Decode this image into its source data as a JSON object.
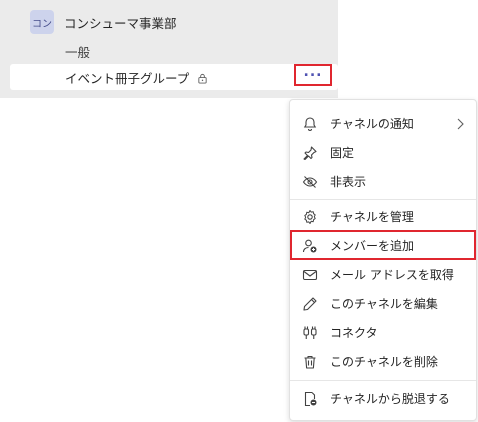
{
  "team": {
    "avatar_text": "コン",
    "name": "コンシューマ事業部"
  },
  "channels": {
    "general": "一般",
    "selected": "イベント冊子グループ"
  },
  "menu": {
    "items": [
      {
        "label": "チャネルの通知",
        "icon": "bell-icon"
      },
      {
        "label": "固定",
        "icon": "pin-icon"
      },
      {
        "label": "非表示",
        "icon": "eye-off-icon"
      },
      {
        "label": "チャネルを管理",
        "icon": "gear-icon"
      },
      {
        "label": "メンバーを追加",
        "icon": "add-member-icon"
      },
      {
        "label": "メール アドレスを取得",
        "icon": "mail-icon"
      },
      {
        "label": "このチャネルを編集",
        "icon": "pencil-icon"
      },
      {
        "label": "コネクタ",
        "icon": "connector-icon"
      },
      {
        "label": "このチャネルを削除",
        "icon": "trash-icon"
      },
      {
        "label": "チャネルから脱退する",
        "icon": "leave-icon"
      }
    ]
  },
  "colors": {
    "highlight": "#e0262f",
    "accent": "#4f52b2",
    "sidebar_bg": "#ebebeb"
  }
}
